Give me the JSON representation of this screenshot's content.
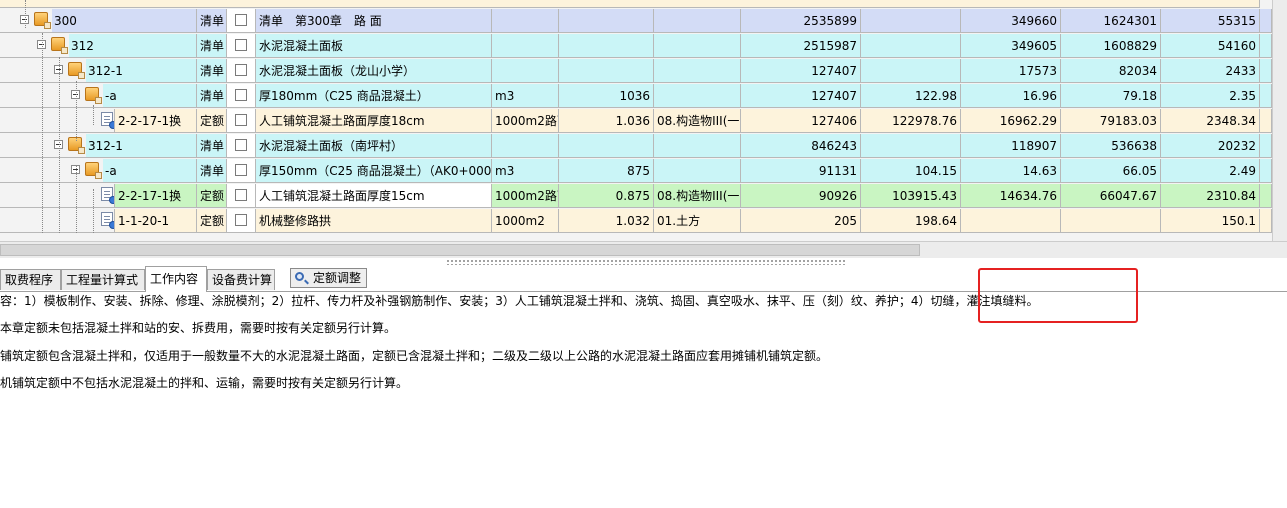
{
  "grid": {
    "rows": [
      {
        "level": 0,
        "code": "300",
        "type": "清单",
        "name": "清单　第300章　路 面",
        "unit": "",
        "qty": "",
        "rate": "",
        "c1": "2535899",
        "c2": "",
        "c3": "349660",
        "c4": "1624301",
        "c5": "55315",
        "bg": "#d3dcf6"
      },
      {
        "level": 1,
        "code": "312",
        "type": "清单",
        "name": "水泥混凝土面板",
        "unit": "",
        "qty": "",
        "rate": "",
        "c1": "2515987",
        "c2": "",
        "c3": "349605",
        "c4": "1608829",
        "c5": "54160",
        "bg": "#caf5f7"
      },
      {
        "level": 2,
        "code": "312-1",
        "type": "清单",
        "name": "水泥混凝土面板（龙山小学）",
        "unit": "",
        "qty": "",
        "rate": "",
        "c1": "127407",
        "c2": "",
        "c3": "17573",
        "c4": "82034",
        "c5": "2433",
        "bg": "#caf5f7"
      },
      {
        "level": 3,
        "code": "-a",
        "type": "清单",
        "name": "厚180mm（C25 商品混凝土）",
        "unit": "m3",
        "qty": "1036",
        "rate": "",
        "c1": "127407",
        "c2": "122.98",
        "c3": "16.96",
        "c4": "79.18",
        "c5": "2.35",
        "bg": "#caf5f7"
      },
      {
        "level": 4,
        "code": "2-2-17-1换",
        "type": "定额",
        "name": "人工铺筑混凝土路面厚度18cm",
        "unit": "1000m2路面",
        "qty": "1.036",
        "rate": "08.构造物III(一",
        "c1": "127406",
        "c2": "122978.76",
        "c3": "16962.29",
        "c4": "79183.03",
        "c5": "2348.34",
        "bg": "#fdf3dc"
      },
      {
        "level": 2,
        "code": "312-1",
        "type": "清单",
        "name": "水泥混凝土面板（南坪村）",
        "unit": "",
        "qty": "",
        "rate": "",
        "c1": "846243",
        "c2": "",
        "c3": "118907",
        "c4": "536638",
        "c5": "20232",
        "bg": "#caf5f7"
      },
      {
        "level": 3,
        "code": "-a",
        "type": "清单",
        "name": "厚150mm（C25 商品混凝土）（AK0+000～AK0",
        "unit": "m3",
        "qty": "875",
        "rate": "",
        "c1": "91131",
        "c2": "104.15",
        "c3": "14.63",
        "c4": "66.05",
        "c5": "2.49",
        "bg": "#caf5f7"
      },
      {
        "level": 4,
        "code": "2-2-17-1换",
        "type": "定额",
        "name": "人工铺筑混凝土路面厚度15cm",
        "unit": "1000m2路面",
        "qty": "0.875",
        "rate": "08.构造物III(一",
        "c1": "90926",
        "c2": "103915.43",
        "c3": "14634.76",
        "c4": "66047.67",
        "c5": "2310.84",
        "bg": "#c9f5c2"
      },
      {
        "level": 4,
        "code": "1-1-20-1",
        "type": "定额",
        "name": "机械整修路拱",
        "unit": "1000m2",
        "qty": "1.032",
        "rate": "01.土方",
        "c1": "205",
        "c2": "198.64",
        "c3": "",
        "c4": "",
        "c5": "150.1",
        "bg": "#fdf3dc"
      }
    ]
  },
  "tabs": [
    {
      "label": "取费程序"
    },
    {
      "label": "工程量计算式"
    },
    {
      "label": "工作内容"
    },
    {
      "label": "设备费计算"
    }
  ],
  "toolbar": {
    "adjust_label": "定额调整"
  },
  "content": {
    "line1": "容：1）模板制作、安装、拆除、修理、涂脱模剂；2）拉杆、传力杆及补强钢筋制作、安装；3）人工铺筑混凝土拌和、浇筑、捣固、真空吸水、抹平、压（刻）纹、养护；4）切缝，灌注填缝料。",
    "line2": "本章定额未包括混凝土拌和站的安、拆费用，需要时按有关定额另行计算。",
    "line3": "铺筑定额包含混凝土拌和，仅适用于一般数量不大的水泥混凝土路面，定额已含混凝土拌和；二级及二级以上公路的水泥混凝土路面应套用摊铺机铺筑定额。",
    "line4": "机铺筑定额中不包括水泥混凝土的拌和、运输，需要时按有关定额另行计算。"
  },
  "colors": {
    "highlight": "#e52121"
  }
}
